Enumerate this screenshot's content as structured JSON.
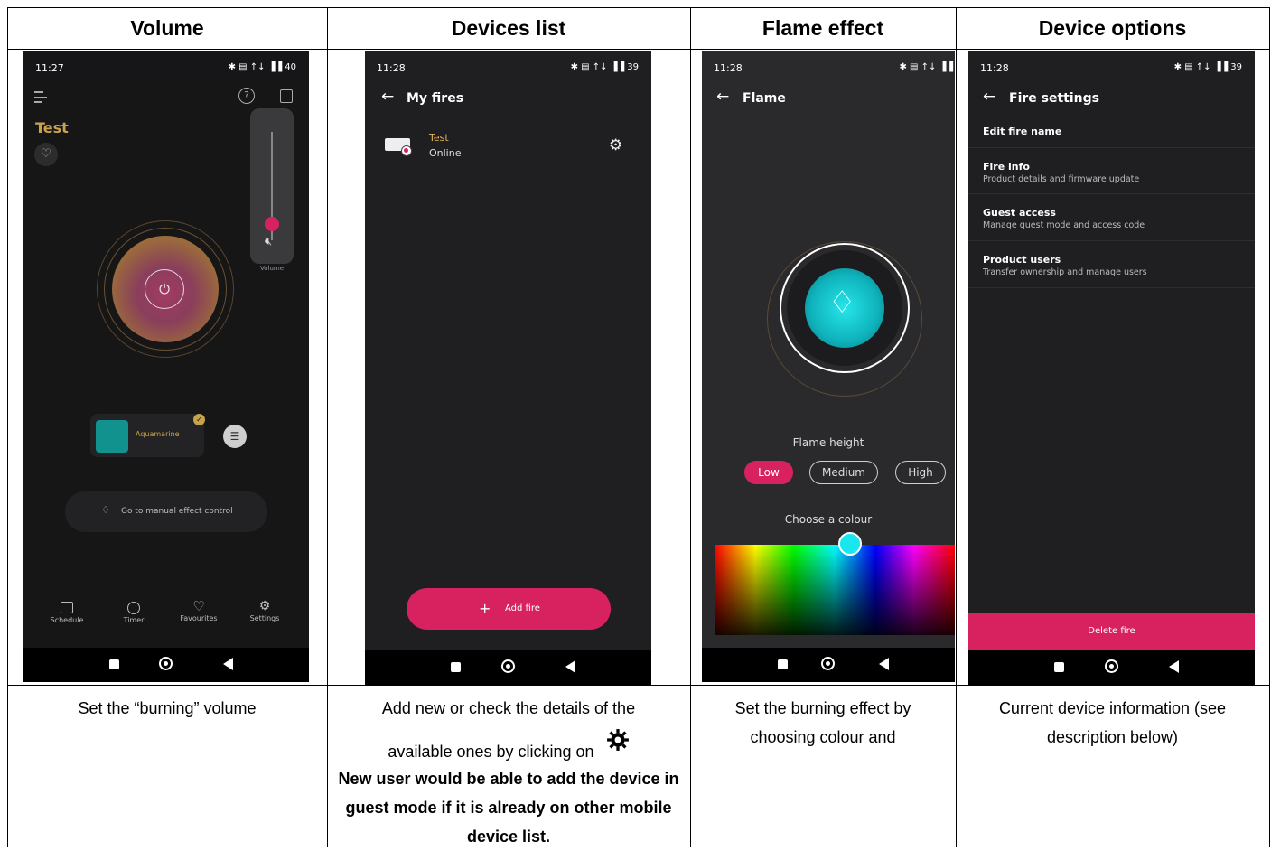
{
  "columns": [
    {
      "header": "Volume"
    },
    {
      "header": "Devices list"
    },
    {
      "header": "Flame effect"
    },
    {
      "header": "Device options"
    }
  ],
  "captions": {
    "volume": "Set the “burning” volume",
    "devices_line1": "Add new or check the details of the",
    "devices_line2": "available ones by clicking on",
    "devices_bold": "New user would be able to add the device in guest mode if it is already on other mobile device list.",
    "flame": "Set the burning effect by choosing  colour and",
    "options": "Current device information (see description below)"
  },
  "volume_screen": {
    "time": "11:27",
    "status_icons": "✱ ▤ ↑↓ ▐▐ 40",
    "fire_name": "Test",
    "volume_label": "Volume",
    "volume_level": 0.15,
    "effect_name": "Aquamarine",
    "effect_color": "#12928f",
    "manual_control": "Go to manual effect control",
    "bottom_nav": [
      "Schedule",
      "Timer",
      "Favourites",
      "Settings"
    ]
  },
  "devices_screen": {
    "time": "11:28",
    "status_icons": "✱ ▤ ↑↓ ▐▐ 39",
    "title": "My fires",
    "device_name": "Test",
    "device_status": "Online",
    "add_button": "Add fire",
    "accent": "#d8215f"
  },
  "flame_screen": {
    "time": "11:28",
    "status_icons": "✱ ▤ ↑↓ ▐▐",
    "title": "Flame",
    "height_label": "Flame height",
    "heights": [
      "Low",
      "Medium",
      "High"
    ],
    "selected_height": "Low",
    "colour_label": "Choose a colour",
    "selected_colour": "#19e6ee"
  },
  "options_screen": {
    "time": "11:28",
    "status_icons": "✱ ▤ ↑↓ ▐▐ 39",
    "title": "Fire settings",
    "items": [
      {
        "title": "Edit fire name",
        "subtitle": ""
      },
      {
        "title": "Fire info",
        "subtitle": "Product details and firmware update"
      },
      {
        "title": "Guest access",
        "subtitle": "Manage guest mode and access code"
      },
      {
        "title": "Product users",
        "subtitle": "Transfer ownership and manage users"
      }
    ],
    "delete_button": "Delete fire"
  }
}
